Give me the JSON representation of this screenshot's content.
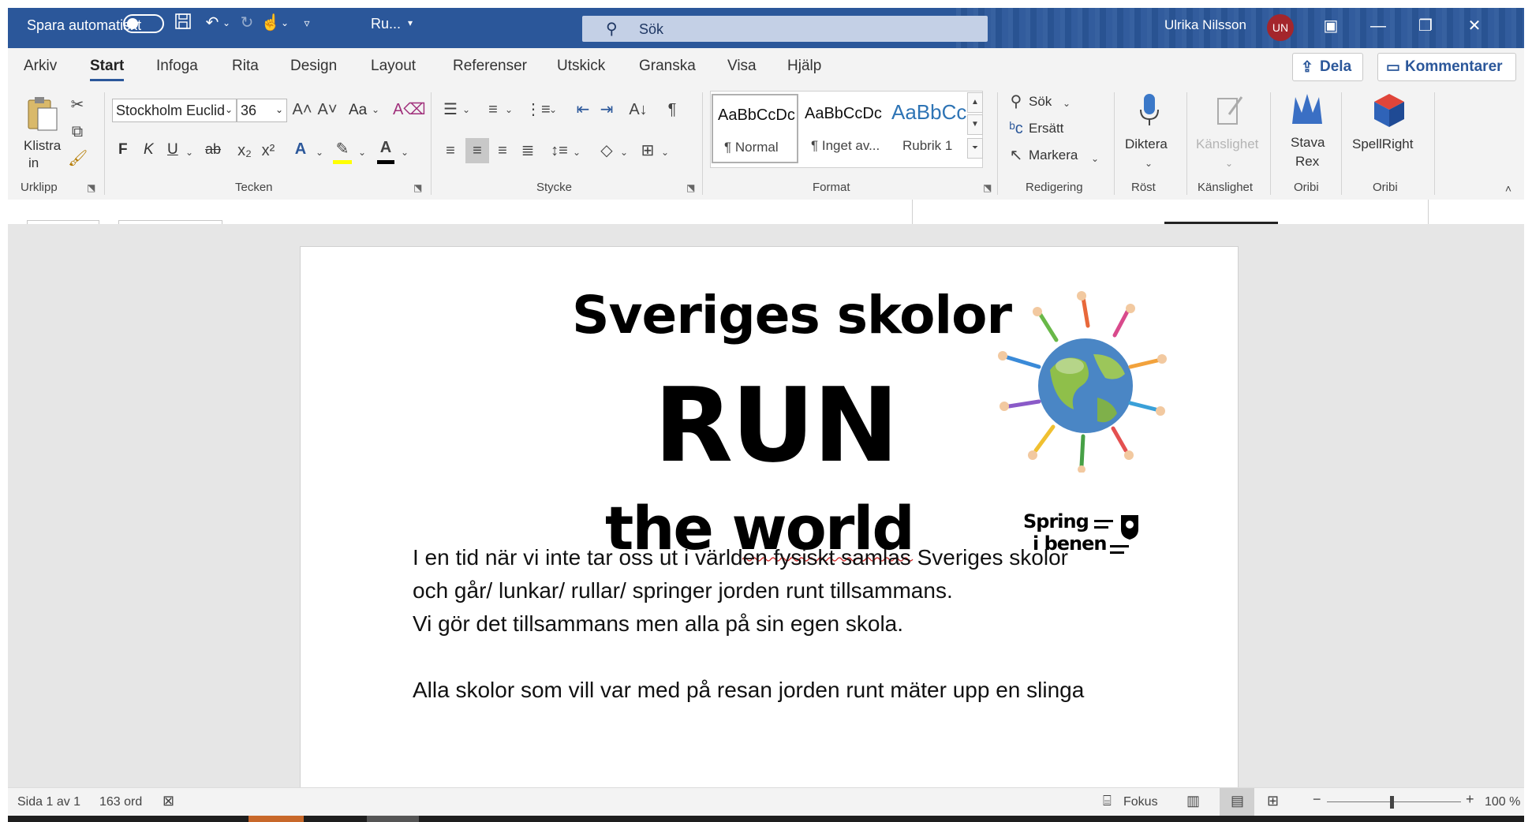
{
  "titlebar": {
    "autosave_label": "Spara automatiskt",
    "doc_name": "Ru...",
    "search_placeholder": "Sök",
    "user_name": "Ulrika Nilsson",
    "user_initials": "UN"
  },
  "menu": {
    "tabs": [
      "Arkiv",
      "Start",
      "Infoga",
      "Rita",
      "Design",
      "Layout",
      "Referenser",
      "Utskick",
      "Granska",
      "Visa",
      "Hjälp"
    ],
    "active_tab": "Start",
    "share_label": "Dela",
    "comments_label": "Kommentarer"
  },
  "ribbon": {
    "clipboard": {
      "paste_label": "Klistra",
      "paste_label2": "in",
      "group_label": "Urklipp"
    },
    "font": {
      "font_name": "Stockholm Euclid",
      "font_size": "36",
      "case_label": "Aa",
      "bold": "F",
      "italic": "K",
      "underline": "U",
      "strike": "ab",
      "group_label": "Tecken"
    },
    "paragraph": {
      "group_label": "Stycke"
    },
    "styles": {
      "tiles": [
        {
          "sample": "AaBbCcDc",
          "name": "¶ Normal"
        },
        {
          "sample": "AaBbCcDc",
          "name": "¶ Inget av..."
        },
        {
          "sample": "AaBbCc",
          "name": "Rubrik 1"
        }
      ],
      "group_label": "Format"
    },
    "editing": {
      "find": "Sök",
      "replace": "Ersätt",
      "select": "Markera",
      "group_label": "Redigering"
    },
    "voice": {
      "dictate": "Diktera",
      "group_label": "Röst"
    },
    "sensitivity": {
      "label": "Känslighet",
      "group_label": "Känslighet"
    },
    "oribi1": {
      "label1": "Stava",
      "label2": "Rex",
      "group_label": "Oribi"
    },
    "oribi2": {
      "label": "SpellRight",
      "group_label": "Oribi"
    }
  },
  "document": {
    "title1": "Sveriges skolor",
    "title2": "RUN",
    "title3": "the world",
    "logo_line1": "Spring",
    "logo_line2": "i benen",
    "paragraphs": [
      "I en tid när vi inte tar oss ut i världen fysiskt samlas Sveriges skolor",
      "och går/ lunkar/ rullar/ springer jorden runt tillsammans.",
      "Vi gör det tillsammans men alla på sin egen skola.",
      "",
      "Alla skolor som vill var med på resan jorden runt mäter upp en slinga"
    ]
  },
  "statusbar": {
    "page": "Sida 1 av 1",
    "words": "163 ord",
    "focus": "Fokus",
    "zoom": "100 %"
  },
  "colors": {
    "accent": "#2b579a",
    "avatar": "#a4262c"
  }
}
